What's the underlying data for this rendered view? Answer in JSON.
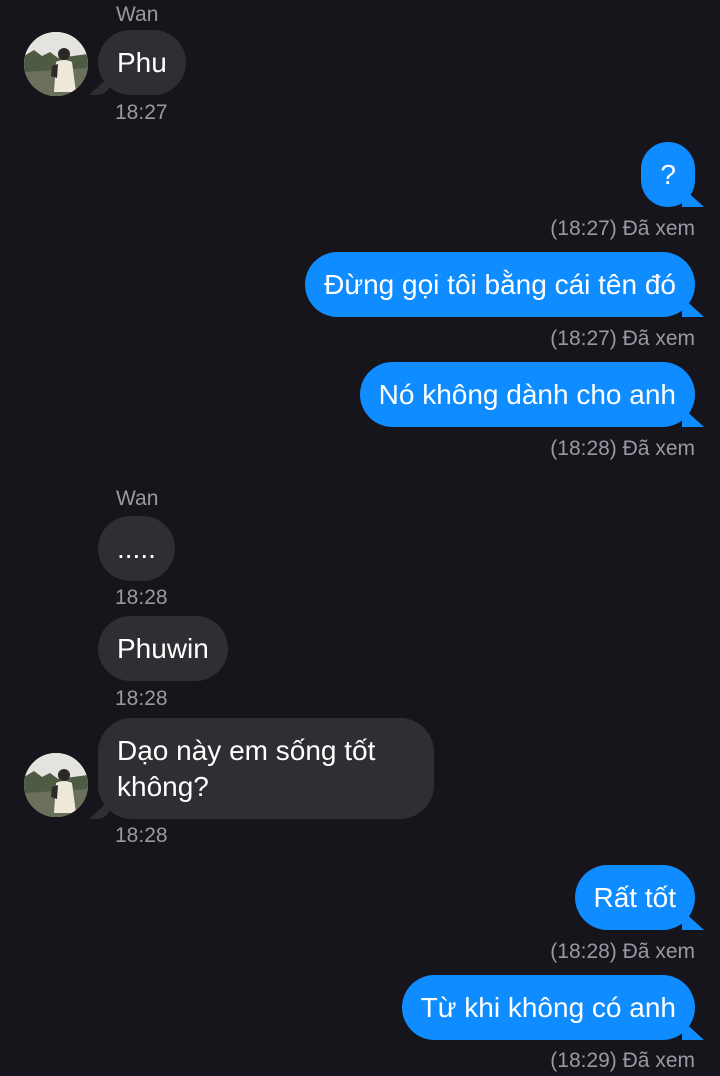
{
  "chat": {
    "messages": [
      {
        "sender": "Wan",
        "text": "Phu",
        "time": "18:27"
      },
      {
        "text": "?",
        "status": "(18:27) Đã xem"
      },
      {
        "text": "Đừng gọi tôi bằng cái tên đó",
        "status": "(18:27) Đã xem"
      },
      {
        "text": "Nó không dành cho anh",
        "status": "(18:28) Đã xem"
      },
      {
        "sender": "Wan",
        "text": ".....",
        "time": "18:28"
      },
      {
        "text": "Phuwin",
        "time": "18:28"
      },
      {
        "text": "Dạo này em sống tốt không?",
        "time": "18:28"
      },
      {
        "text": "Rất tốt",
        "status": "(18:28) Đã xem"
      },
      {
        "text": "Từ khi không có anh",
        "status": "(18:29) Đã xem"
      }
    ]
  },
  "colors": {
    "background": "#17151c",
    "incoming_bubble": "#2f2e33",
    "outgoing_bubble": "#0f8cff",
    "meta_text": "#9a99a1"
  },
  "icons": {
    "avatar": "contact-photo"
  }
}
